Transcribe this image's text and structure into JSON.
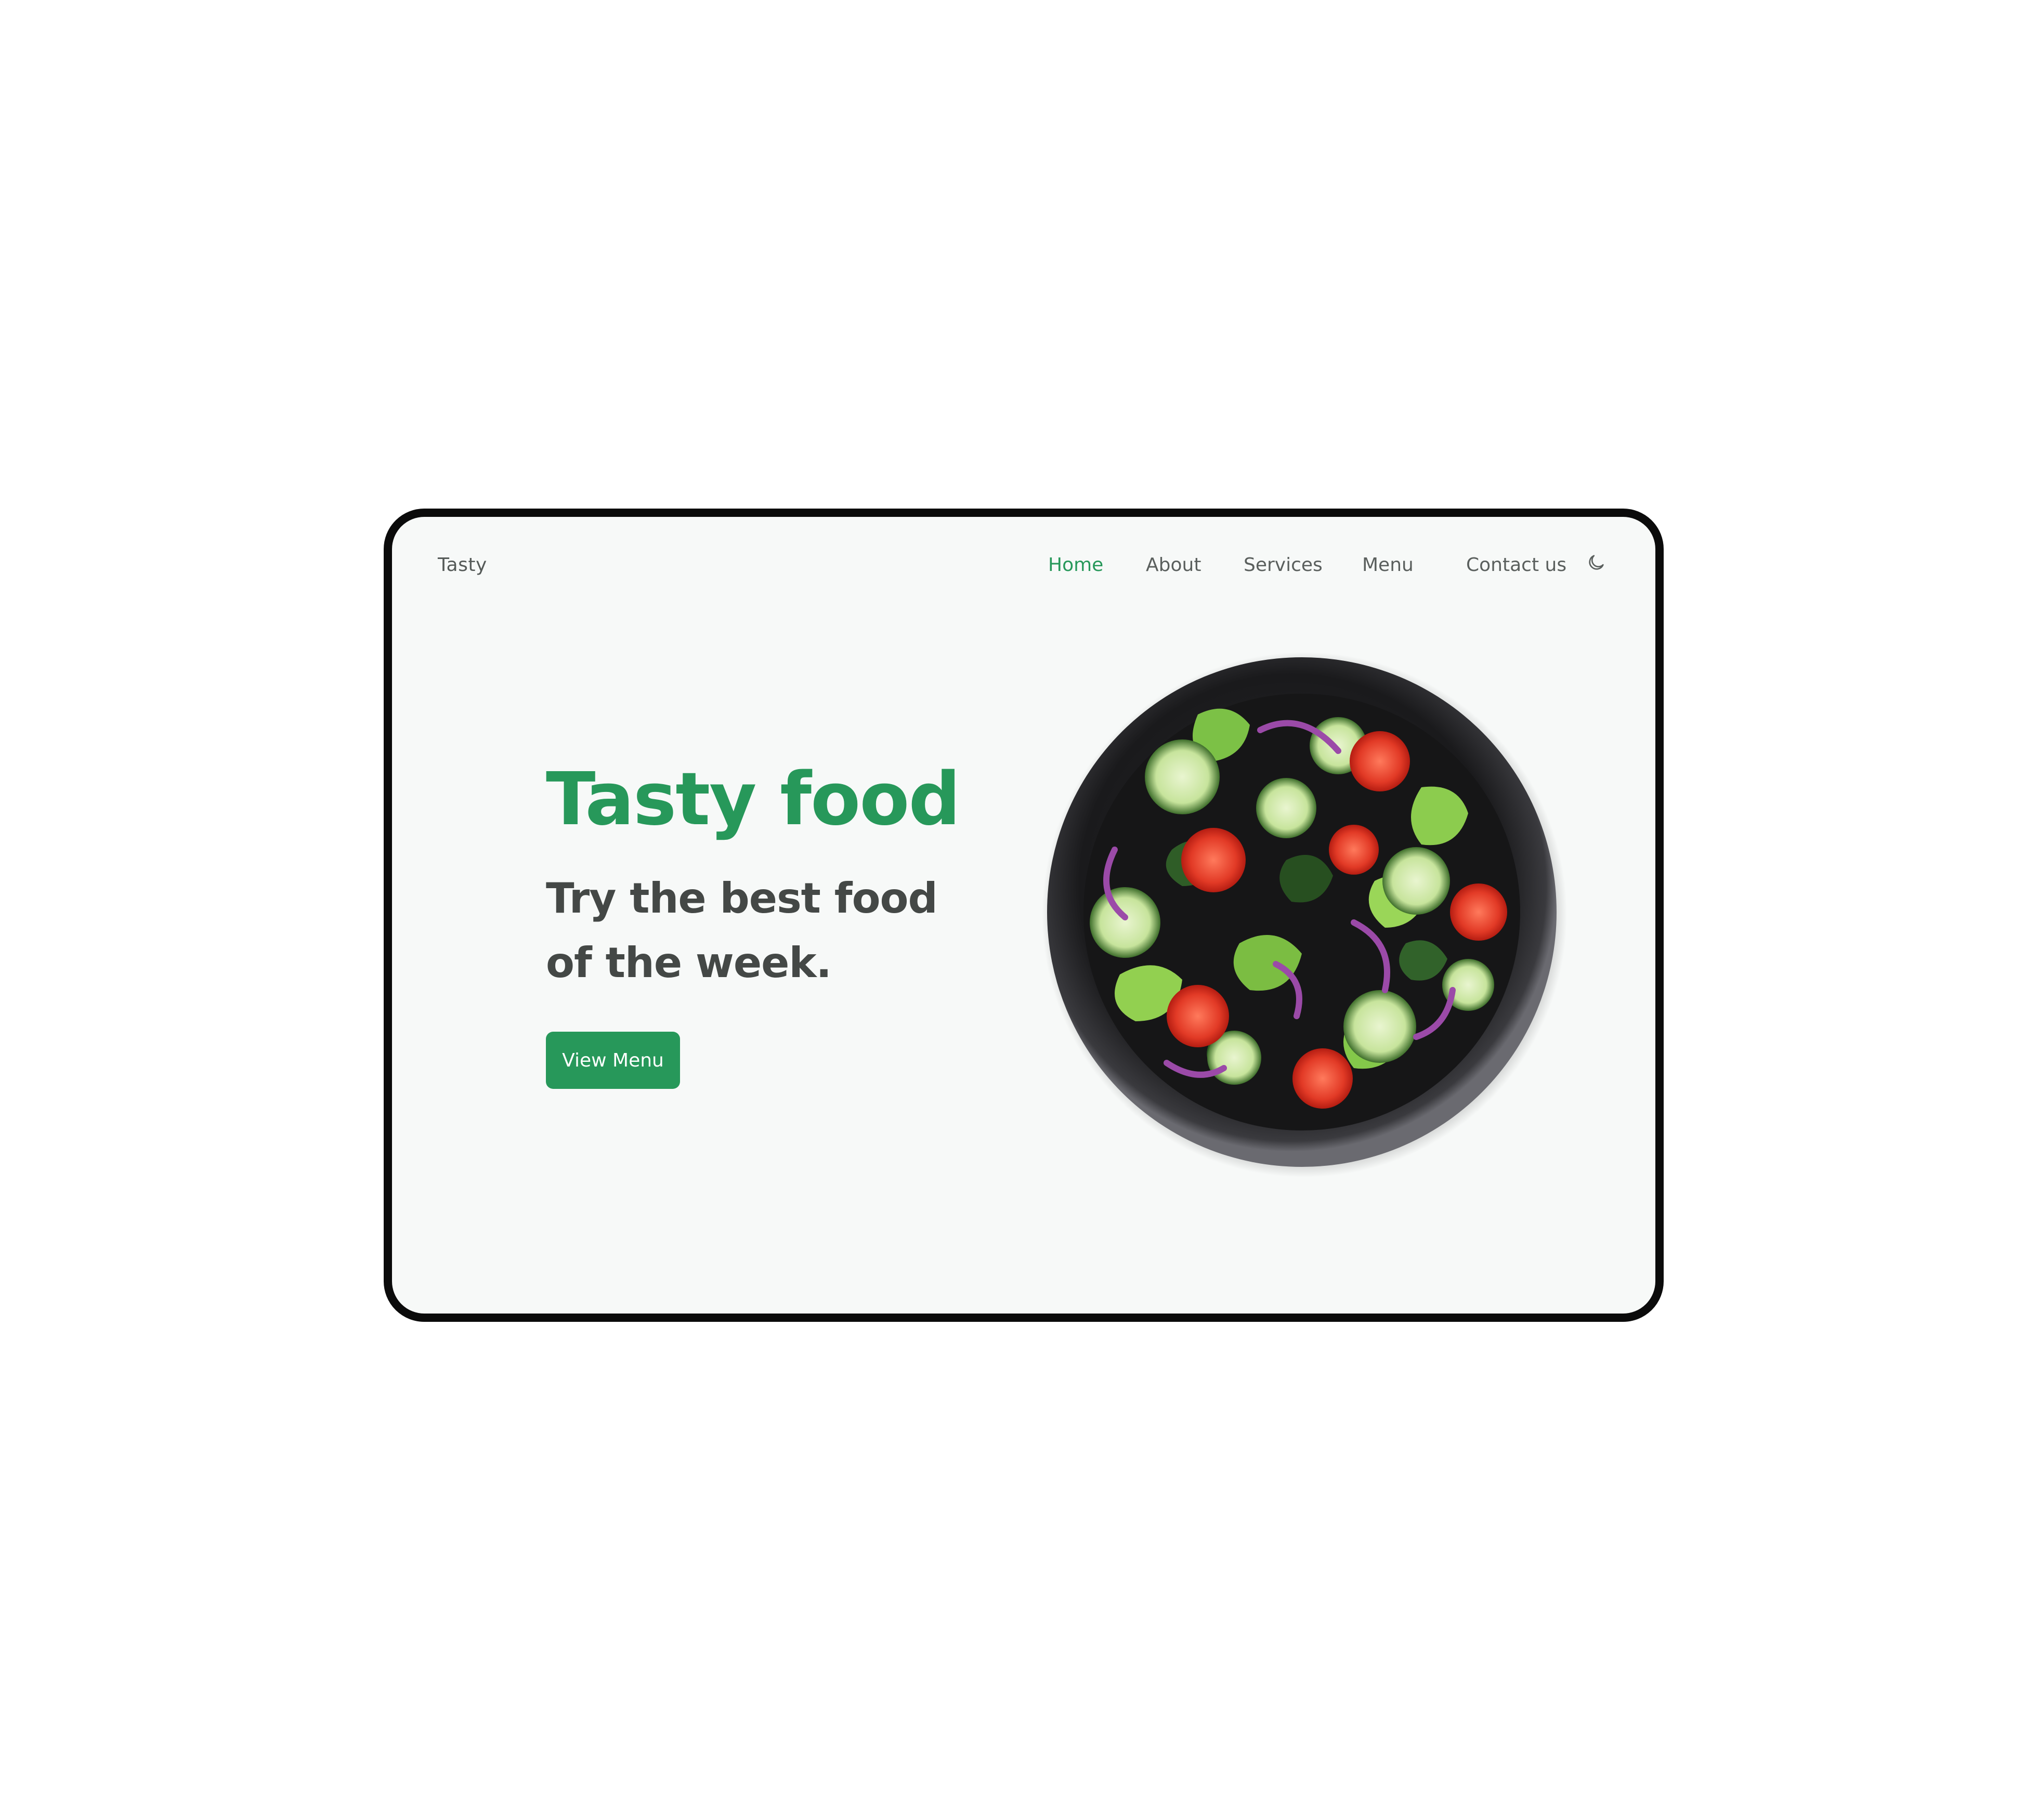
{
  "nav": {
    "logo": "Tasty",
    "items": [
      {
        "label": "Home",
        "active": true
      },
      {
        "label": "About",
        "active": false
      },
      {
        "label": "Services",
        "active": false
      },
      {
        "label": "Menu",
        "active": false
      },
      {
        "label": "Contact us",
        "active": false
      }
    ],
    "theme_icon": "moon-icon"
  },
  "hero": {
    "title": "Tasty food",
    "subtitle": "Try the best food of the week.",
    "button_label": "View Menu",
    "image_icon": "salad-bowl-image"
  },
  "colors": {
    "accent": "#27985a",
    "text": "#444846",
    "background": "#f7f9f8",
    "frame": "#0b0b0b"
  }
}
